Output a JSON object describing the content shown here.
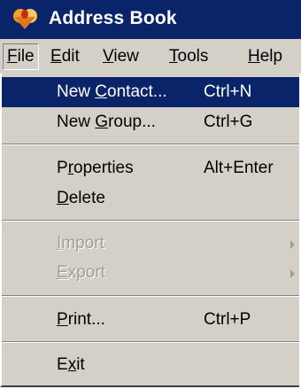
{
  "window": {
    "title": "Address Book",
    "icon": "address-book-icon"
  },
  "menubar": {
    "items": [
      {
        "pre": "",
        "key": "F",
        "post": "ile"
      },
      {
        "pre": "",
        "key": "E",
        "post": "dit"
      },
      {
        "pre": "",
        "key": "V",
        "post": "iew"
      },
      {
        "pre": "",
        "key": "T",
        "post": "ools"
      },
      {
        "pre": "",
        "key": "H",
        "post": "elp"
      }
    ]
  },
  "file_menu": {
    "new_contact": {
      "pre": "New ",
      "key": "C",
      "post": "ontact...",
      "shortcut": "Ctrl+N"
    },
    "new_group": {
      "pre": "New ",
      "key": "G",
      "post": "roup...",
      "shortcut": "Ctrl+G"
    },
    "properties": {
      "pre": "P",
      "key": "r",
      "post": "operties",
      "shortcut": "Alt+Enter"
    },
    "delete": {
      "pre": "",
      "key": "D",
      "post": "elete"
    },
    "import": {
      "pre": "",
      "key": "I",
      "post": "mport"
    },
    "export": {
      "pre": "",
      "key": "E",
      "post": "xport"
    },
    "print": {
      "pre": "",
      "key": "P",
      "post": "rint...",
      "shortcut": "Ctrl+P"
    },
    "exit": {
      "pre": "E",
      "key": "x",
      "post": "it"
    }
  },
  "colors": {
    "highlight": "#0a246a",
    "menu_bg": "#d4d0c8",
    "disabled_text": "#a09e98"
  }
}
